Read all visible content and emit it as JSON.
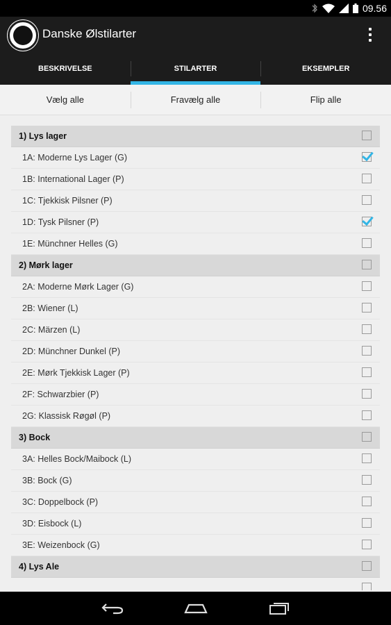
{
  "status": {
    "time": "09.56"
  },
  "app": {
    "title": "Danske Ølstilarter"
  },
  "tabs": [
    {
      "label": "BESKRIVELSE",
      "active": false
    },
    {
      "label": "STILARTER",
      "active": true
    },
    {
      "label": "EKSEMPLER",
      "active": false
    }
  ],
  "actions": {
    "select_all": "Vælg alle",
    "deselect_all": "Fravælg alle",
    "flip_all": "Flip alle"
  },
  "accent_color": "#33b5e5",
  "list": [
    {
      "label": "1) Lys lager",
      "group": true,
      "checked": false
    },
    {
      "label": "1A: Moderne Lys Lager (G)",
      "group": false,
      "checked": true
    },
    {
      "label": "1B: International Lager (P)",
      "group": false,
      "checked": false
    },
    {
      "label": "1C: Tjekkisk Pilsner (P)",
      "group": false,
      "checked": false
    },
    {
      "label": "1D: Tysk Pilsner (P)",
      "group": false,
      "checked": true
    },
    {
      "label": "1E: Münchner Helles (G)",
      "group": false,
      "checked": false
    },
    {
      "label": "2) Mørk lager",
      "group": true,
      "checked": false
    },
    {
      "label": "2A: Moderne Mørk Lager (G)",
      "group": false,
      "checked": false
    },
    {
      "label": "2B: Wiener (L)",
      "group": false,
      "checked": false
    },
    {
      "label": "2C: Märzen (L)",
      "group": false,
      "checked": false
    },
    {
      "label": "2D: Münchner Dunkel (P)",
      "group": false,
      "checked": false
    },
    {
      "label": "2E: Mørk Tjekkisk Lager (P)",
      "group": false,
      "checked": false
    },
    {
      "label": "2F: Schwarzbier (P)",
      "group": false,
      "checked": false
    },
    {
      "label": "2G: Klassisk Røgøl (P)",
      "group": false,
      "checked": false
    },
    {
      "label": "3) Bock",
      "group": true,
      "checked": false
    },
    {
      "label": "3A: Helles Bock/Maibock (L)",
      "group": false,
      "checked": false
    },
    {
      "label": "3B: Bock (G)",
      "group": false,
      "checked": false
    },
    {
      "label": "3C: Doppelbock (P)",
      "group": false,
      "checked": false
    },
    {
      "label": "3D: Eisbock (L)",
      "group": false,
      "checked": false
    },
    {
      "label": "3E: Weizenbock (G)",
      "group": false,
      "checked": false
    },
    {
      "label": "4) Lys Ale",
      "group": true,
      "checked": false
    },
    {
      "label": "",
      "group": false,
      "checked": false
    }
  ]
}
